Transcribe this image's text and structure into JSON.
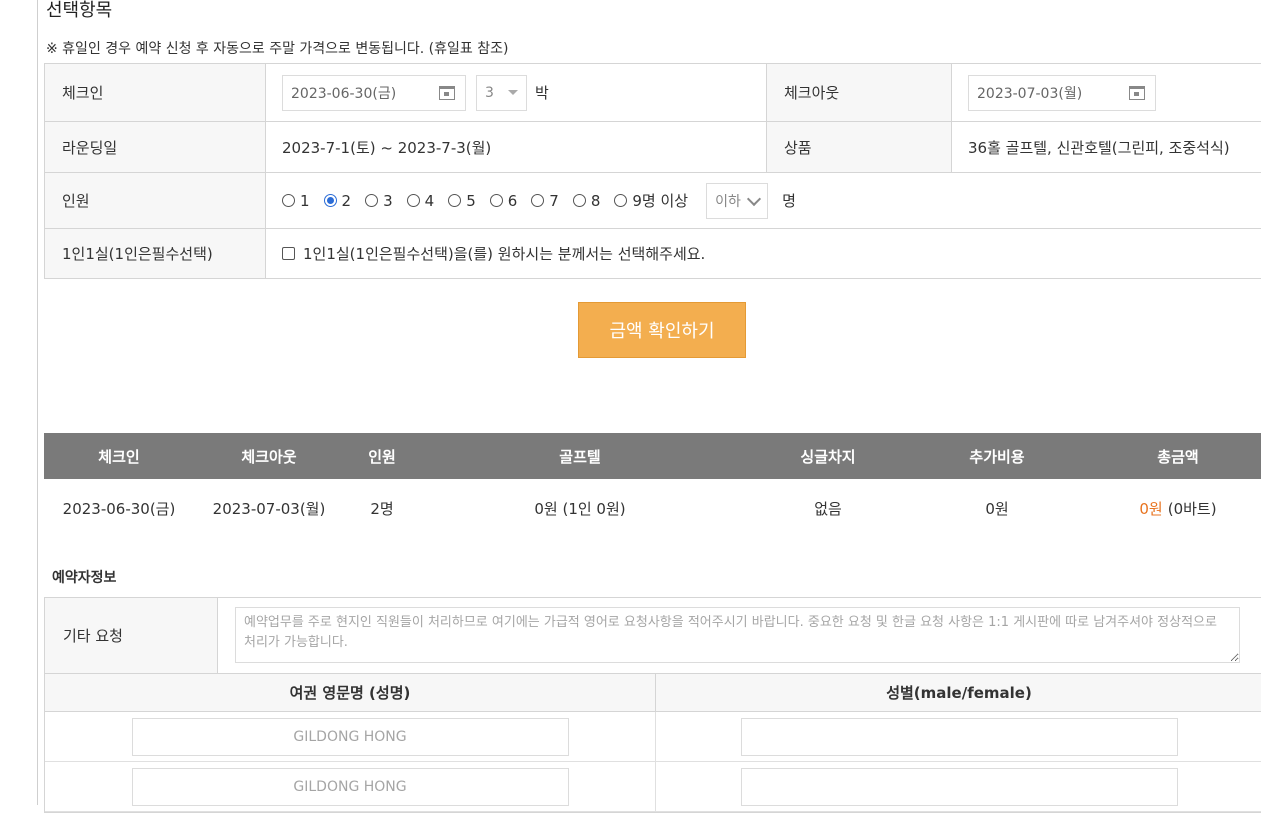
{
  "section_title": "선택항목",
  "notice": "※ 휴일인 경우 예약 신청 후 자동으로 주말 가격으로 변동됩니다. (휴일표 참조)",
  "booking": {
    "checkin_label": "체크인",
    "checkin_date": "2023-06-30(금)",
    "nights_value": "3",
    "nights_unit": "박",
    "checkout_label": "체크아웃",
    "checkout_date": "2023-07-03(월)",
    "rounding_label": "라운딩일",
    "rounding_value": "2023-7-1(토) ~ 2023-7-3(월)",
    "product_label": "상품",
    "product_value": "36홀 골프텔, 신관호텔(그린피, 조중석식)",
    "people_label": "인원",
    "people_options": [
      "1",
      "2",
      "3",
      "4",
      "5",
      "6",
      "7",
      "8",
      "9명 이상"
    ],
    "people_selected": "2",
    "extra_select": "이하",
    "people_unit": "명",
    "single_label": "1인1실(1인은필수선택)",
    "single_checkbox_text": "1인1실(1인은필수선택)을(를) 원하시는 분께서는 선택해주세요."
  },
  "price_button": "금액 확인하기",
  "summary": {
    "headers": [
      "체크인",
      "체크아웃",
      "인원",
      "골프텔",
      "싱글차지",
      "추가비용",
      "총금액"
    ],
    "row": {
      "checkin": "2023-06-30(금)",
      "checkout": "2023-07-03(월)",
      "people": "2명",
      "golftel": "0원 (1인 0원)",
      "single": "없음",
      "extra": "0원",
      "total": "0원",
      "total_baht": "(0바트)"
    }
  },
  "reservation_title": "예약자정보",
  "request": {
    "label": "기타 요청",
    "placeholder": "예약업무를 주로 현지인 직원들이 처리하므로 여기에는 가급적 영어로 요청사항을 적어주시기 바랍니다. 중요한 요청 및 한글 요청 사항은 1:1 게시판에 따로 남겨주셔야 정상적으로 처리가 가능합니다."
  },
  "passport": {
    "name_header": "여권 영문명 (성명)",
    "gender_header": "성별(male/female)",
    "name_placeholder": "GILDONG HONG"
  },
  "colors": {
    "accent_button": "#f3ae4f",
    "summary_header": "#7a7a7a",
    "total_price": "#e8731f",
    "radio_selected": "#2b6cd6"
  }
}
